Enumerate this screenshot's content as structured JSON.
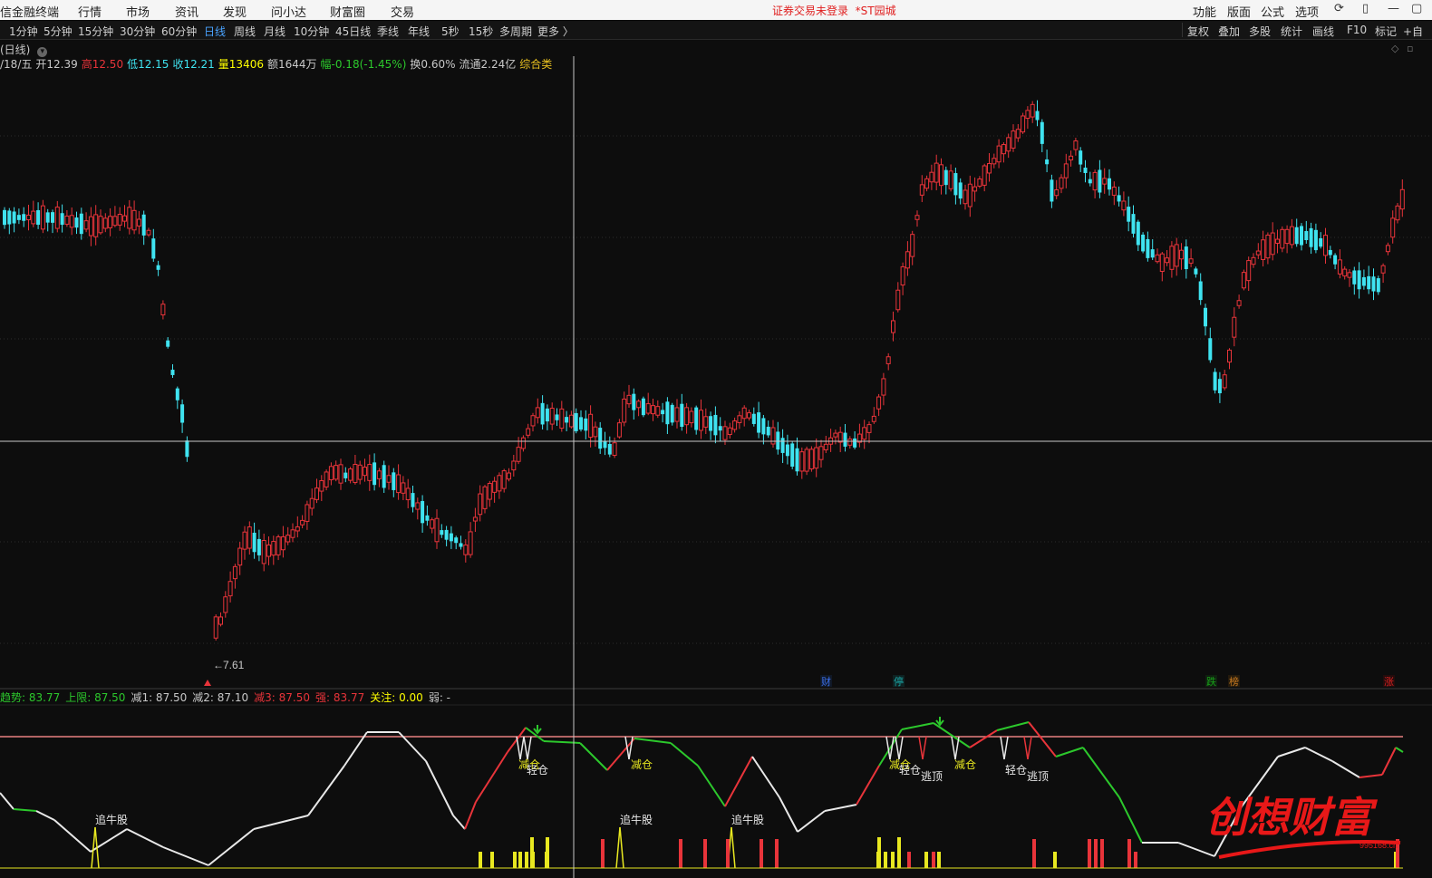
{
  "menu": {
    "app_title": "信金融终端",
    "items": [
      "行情",
      "市场",
      "资讯",
      "发现",
      "问小达",
      "财富圈",
      "交易"
    ],
    "notice": "证券交易未登录",
    "notice_link": "*ST园城",
    "right_items": [
      "功能",
      "版面",
      "公式",
      "选项"
    ]
  },
  "periods": [
    "1分钟",
    "5分钟",
    "15分钟",
    "30分钟",
    "60分钟",
    "日线",
    "周线",
    "月线",
    "10分钟",
    "45日线",
    "季线",
    "年线",
    "5秒",
    "15秒",
    "多周期",
    "更多 〉"
  ],
  "active_period": "日线",
  "right_tools": [
    "复权",
    "叠加",
    "多股",
    "统计",
    "画线",
    "F10",
    "标记",
    "+自"
  ],
  "chart_label": "(日线)",
  "quote": {
    "date": "/18/五",
    "open": "开12.39",
    "high": "高12.50",
    "low": "低12.15",
    "close": "收12.21",
    "volume": "量13406",
    "amount": "额1644万",
    "change": "幅-0.18(-1.45%)",
    "turnover": "换0.60%",
    "float": "流通2.24亿",
    "sector": "综合类"
  },
  "colors": {
    "up": "#e8343a",
    "down": "#3fe3f0",
    "background": "#0d0d0d",
    "crosshair": "#c8c8c8",
    "yellow": "#ffff00",
    "green": "#2cc82c"
  },
  "low_marker": "7.61",
  "event_tags": [
    {
      "text": "财",
      "color": "#3a6ee8"
    },
    {
      "text": "停",
      "color": "#1aa5a5"
    },
    {
      "text": "跌",
      "color": "#18a018"
    },
    {
      "text": "榜",
      "color": "#c87a20"
    },
    {
      "text": "涨",
      "color": "#d82020"
    }
  ],
  "indicator": {
    "trend": "趋势: 83.77",
    "upper": "上限: 87.50",
    "jian1": "减1: 87.50",
    "jian2": "减2: 87.10",
    "jian3": "减3: 87.50",
    "strong": "强: 83.77",
    "focus": "关注: 0.00",
    "weak": "弱: -"
  },
  "indicator_labels": {
    "zhuiniu": "追牛股",
    "jiancang": "减仓",
    "qingcang": "轻仓",
    "taoding": "逃顶"
  },
  "watermark": {
    "title": "创想财富",
    "site": "995168.cn"
  }
}
